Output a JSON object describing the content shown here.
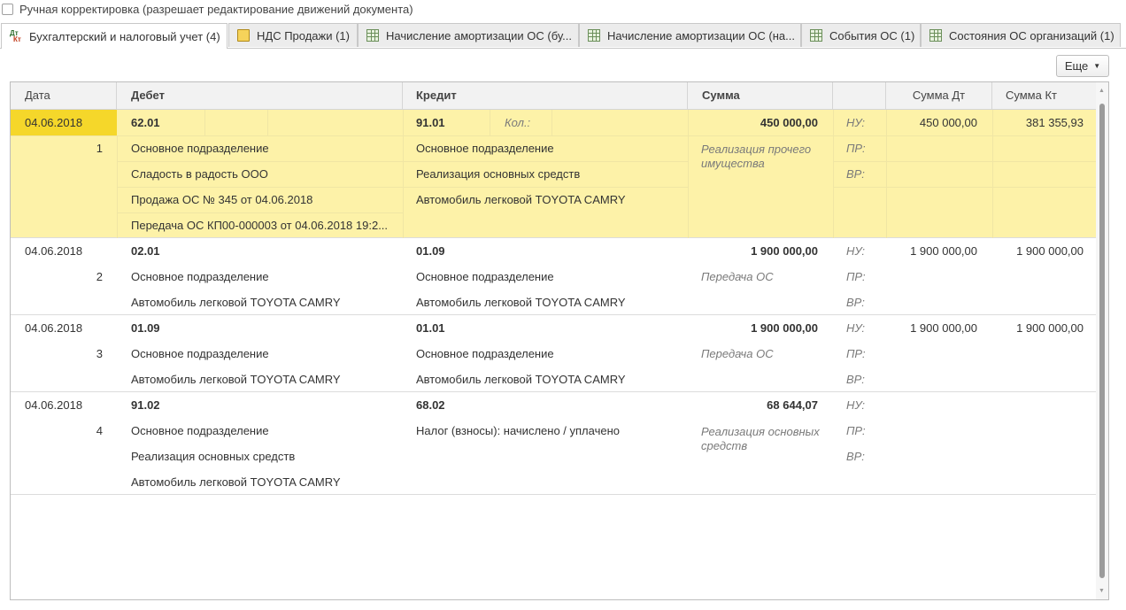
{
  "manual_edit": {
    "label": "Ручная корректировка (разрешает редактирование движений документа)",
    "checked": false
  },
  "tabs": [
    {
      "label": "Бухгалтерский и налоговый учет (4)",
      "icon": "dtkt-icon",
      "active": true
    },
    {
      "label": "НДС Продажи (1)",
      "icon": "document-icon",
      "active": false
    },
    {
      "label": "Начисление амортизации ОС (бу...",
      "icon": "register-grid-icon",
      "active": false
    },
    {
      "label": "Начисление амортизации ОС (на...",
      "icon": "register-grid-icon",
      "active": false
    },
    {
      "label": "События ОС (1)",
      "icon": "register-grid-icon",
      "active": false
    },
    {
      "label": "Состояния ОС организаций (1)",
      "icon": "register-grid-icon",
      "active": false
    }
  ],
  "icon_text": {
    "dt": "Дт",
    "kt": "Кт"
  },
  "toolbar": {
    "more_label": "Еще"
  },
  "columns": {
    "date": "Дата",
    "debit": "Дебет",
    "credit": "Кредит",
    "sum": "Сумма",
    "blank": "",
    "sum_dt": "Сумма Дт",
    "sum_kt": "Сумма Кт"
  },
  "records": [
    {
      "date": "04.06.2018",
      "num": "1",
      "debit_account": "62.01",
      "debit_subconto": [
        "Основное подразделение",
        "Сладость в радость ООО",
        "Продажа ОС № 345 от 04.06.2018",
        "Передача ОС КП00-000003 от 04.06.2018 19:2..."
      ],
      "credit_account": "91.01",
      "credit_qty_label": "Кол.:",
      "credit_subconto": [
        "Основное подразделение",
        "Реализация основных средств",
        "Автомобиль легковой TOYOTA CAMRY"
      ],
      "sum": "450 000,00",
      "content": "Реализация прочего имущества",
      "nu": "НУ:",
      "pr": "ПР:",
      "vr": "ВР:",
      "sum_dt": "450 000,00",
      "sum_kt": "381 355,93"
    },
    {
      "date": "04.06.2018",
      "num": "2",
      "debit_account": "02.01",
      "debit_subconto": [
        "Основное подразделение",
        "Автомобиль легковой TOYOTA CAMRY"
      ],
      "credit_account": "01.09",
      "credit_subconto": [
        "Основное подразделение",
        "Автомобиль легковой TOYOTA CAMRY"
      ],
      "sum": "1 900 000,00",
      "content": "Передача ОС",
      "nu": "НУ:",
      "pr": "ПР:",
      "vr": "ВР:",
      "sum_dt": "1 900 000,00",
      "sum_kt": "1 900 000,00"
    },
    {
      "date": "04.06.2018",
      "num": "3",
      "debit_account": "01.09",
      "debit_subconto": [
        "Основное подразделение",
        "Автомобиль легковой TOYOTA CAMRY"
      ],
      "credit_account": "01.01",
      "credit_subconto": [
        "Основное подразделение",
        "Автомобиль легковой TOYOTA CAMRY"
      ],
      "sum": "1 900 000,00",
      "content": "Передача ОС",
      "nu": "НУ:",
      "pr": "ПР:",
      "vr": "ВР:",
      "sum_dt": "1 900 000,00",
      "sum_kt": "1 900 000,00"
    },
    {
      "date": "04.06.2018",
      "num": "4",
      "debit_account": "91.02",
      "debit_subconto": [
        "Основное подразделение",
        "Реализация основных средств",
        "Автомобиль легковой TOYOTA CAMRY"
      ],
      "credit_account": "68.02",
      "credit_subconto": [
        "Налог (взносы): начислено / уплачено"
      ],
      "sum": "68 644,07",
      "content": "Реализация основных средств",
      "nu": "НУ:",
      "pr": "ПР:",
      "vr": "ВР:",
      "sum_dt": "",
      "sum_kt": ""
    }
  ],
  "colors": {
    "selected_row": "#fdf2a8",
    "selected_date": "#f5d72a"
  }
}
